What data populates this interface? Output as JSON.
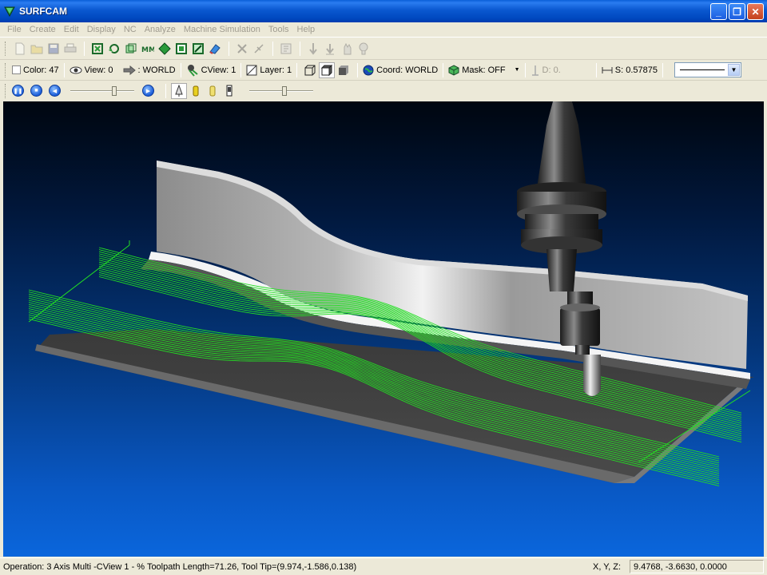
{
  "window": {
    "title": "SURFCAM"
  },
  "menu": [
    "File",
    "Create",
    "Edit",
    "Display",
    "NC",
    "Analyze",
    "Machine Simulation",
    "Tools",
    "Help"
  ],
  "toolbar2": {
    "color": "Color: 47",
    "view": "View: 0",
    "view_name": ": WORLD",
    "cview": "CView: 1",
    "layer": "Layer: 1",
    "coord": "Coord: WORLD",
    "mask": "Mask: OFF",
    "depth": "D: 0.",
    "spacing": "S: 0.57875"
  },
  "simulation": {
    "speed_level": 0.7,
    "size_level": 0.55
  },
  "status": {
    "operation": "Operation: 3 Axis Multi -CView 1 - % Toolpath Length=71.26, Tool Tip=(9.974,-1.586,0.138)",
    "xyz_label": "X, Y, Z:",
    "coords": "9.4768, -3.6630, 0.0000"
  },
  "colors": {
    "toolpath": "#22e022",
    "viewport_top": "#00060f",
    "viewport_bottom": "#0a66dc"
  }
}
